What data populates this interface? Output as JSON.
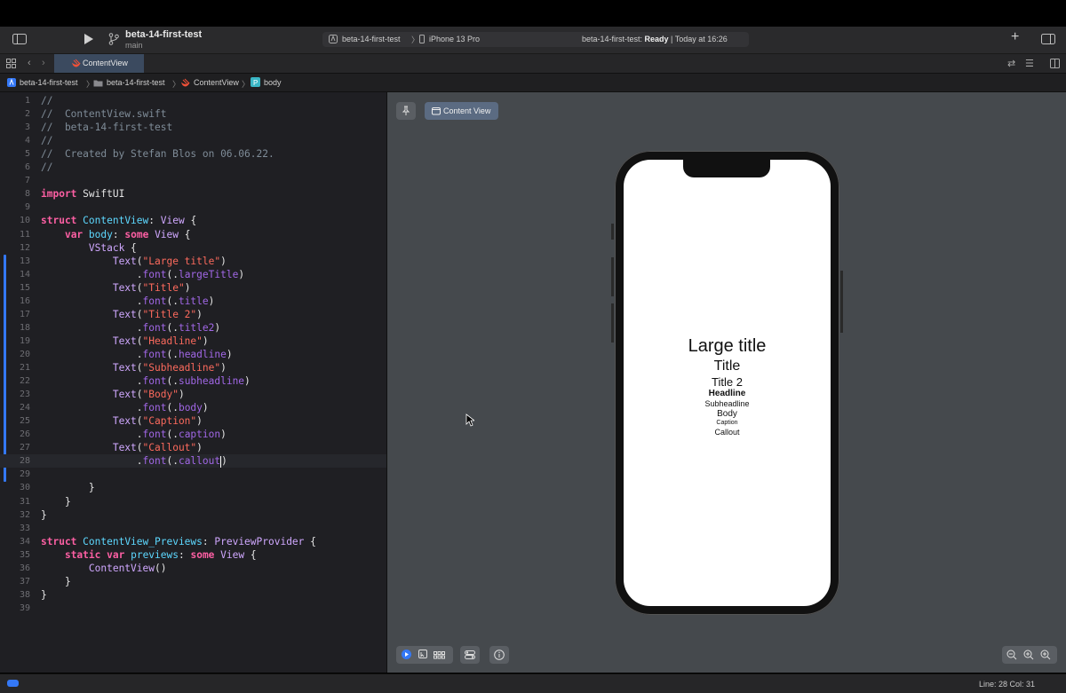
{
  "window": {
    "project_title": "beta-14-first-test",
    "branch": "main",
    "scheme": "beta-14-first-test",
    "device": "iPhone 13 Pro",
    "status_prefix": "beta-14-first-test: ",
    "status_ready": "Ready",
    "status_suffix": " | Today at 16:26"
  },
  "tabs": [
    {
      "label": "ContentView"
    }
  ],
  "jumpbar": [
    "beta-14-first-test",
    "beta-14-first-test",
    "ContentView",
    "body"
  ],
  "editor": {
    "current_line": 28,
    "lines": [
      {
        "n": "1",
        "t": [
          [
            "c",
            "//"
          ]
        ]
      },
      {
        "n": "2",
        "t": [
          [
            "c",
            "//  ContentView.swift"
          ]
        ]
      },
      {
        "n": "3",
        "t": [
          [
            "c",
            "//  beta-14-first-test"
          ]
        ]
      },
      {
        "n": "4",
        "t": [
          [
            "c",
            "//"
          ]
        ]
      },
      {
        "n": "5",
        "t": [
          [
            "c",
            "//  Created by Stefan Blos on 06.06.22."
          ]
        ]
      },
      {
        "n": "6",
        "t": [
          [
            "c",
            "//"
          ]
        ]
      },
      {
        "n": "7",
        "t": []
      },
      {
        "n": "8",
        "t": [
          [
            "k",
            "import"
          ],
          [
            "p",
            " SwiftUI"
          ]
        ]
      },
      {
        "n": "9",
        "t": []
      },
      {
        "n": "10",
        "t": [
          [
            "k",
            "struct"
          ],
          [
            "p",
            " "
          ],
          [
            "d",
            "ContentView"
          ],
          [
            "p",
            ": "
          ],
          [
            "y",
            "View"
          ],
          [
            "p",
            " {"
          ]
        ]
      },
      {
        "n": "11",
        "t": [
          [
            "p",
            "    "
          ],
          [
            "k",
            "var"
          ],
          [
            "p",
            " "
          ],
          [
            "d",
            "body"
          ],
          [
            "p",
            ": "
          ],
          [
            "k",
            "some"
          ],
          [
            "p",
            " "
          ],
          [
            "y",
            "View"
          ],
          [
            "p",
            " {"
          ]
        ]
      },
      {
        "n": "12",
        "t": [
          [
            "p",
            "        "
          ],
          [
            "y",
            "VStack"
          ],
          [
            "p",
            " {"
          ]
        ]
      },
      {
        "n": "13",
        "t": [
          [
            "p",
            "            "
          ],
          [
            "y",
            "Text"
          ],
          [
            "p",
            "("
          ],
          [
            "s",
            "\"Large title\""
          ],
          [
            "p",
            ")"
          ]
        ]
      },
      {
        "n": "14",
        "t": [
          [
            "p",
            "                ."
          ],
          [
            "f",
            "font"
          ],
          [
            "p",
            "(."
          ],
          [
            "f",
            "largeTitle"
          ],
          [
            "p",
            ")"
          ]
        ]
      },
      {
        "n": "15",
        "t": [
          [
            "p",
            "            "
          ],
          [
            "y",
            "Text"
          ],
          [
            "p",
            "("
          ],
          [
            "s",
            "\"Title\""
          ],
          [
            "p",
            ")"
          ]
        ]
      },
      {
        "n": "16",
        "t": [
          [
            "p",
            "                ."
          ],
          [
            "f",
            "font"
          ],
          [
            "p",
            "(."
          ],
          [
            "f",
            "title"
          ],
          [
            "p",
            ")"
          ]
        ]
      },
      {
        "n": "17",
        "t": [
          [
            "p",
            "            "
          ],
          [
            "y",
            "Text"
          ],
          [
            "p",
            "("
          ],
          [
            "s",
            "\"Title 2\""
          ],
          [
            "p",
            ")"
          ]
        ]
      },
      {
        "n": "18",
        "t": [
          [
            "p",
            "                ."
          ],
          [
            "f",
            "font"
          ],
          [
            "p",
            "(."
          ],
          [
            "f",
            "title2"
          ],
          [
            "p",
            ")"
          ]
        ]
      },
      {
        "n": "19",
        "t": [
          [
            "p",
            "            "
          ],
          [
            "y",
            "Text"
          ],
          [
            "p",
            "("
          ],
          [
            "s",
            "\"Headline\""
          ],
          [
            "p",
            ")"
          ]
        ]
      },
      {
        "n": "20",
        "t": [
          [
            "p",
            "                ."
          ],
          [
            "f",
            "font"
          ],
          [
            "p",
            "(."
          ],
          [
            "f",
            "headline"
          ],
          [
            "p",
            ")"
          ]
        ]
      },
      {
        "n": "21",
        "t": [
          [
            "p",
            "            "
          ],
          [
            "y",
            "Text"
          ],
          [
            "p",
            "("
          ],
          [
            "s",
            "\"Subheadline\""
          ],
          [
            "p",
            ")"
          ]
        ]
      },
      {
        "n": "22",
        "t": [
          [
            "p",
            "                ."
          ],
          [
            "f",
            "font"
          ],
          [
            "p",
            "(."
          ],
          [
            "f",
            "subheadline"
          ],
          [
            "p",
            ")"
          ]
        ]
      },
      {
        "n": "23",
        "t": [
          [
            "p",
            "            "
          ],
          [
            "y",
            "Text"
          ],
          [
            "p",
            "("
          ],
          [
            "s",
            "\"Body\""
          ],
          [
            "p",
            ")"
          ]
        ]
      },
      {
        "n": "24",
        "t": [
          [
            "p",
            "                ."
          ],
          [
            "f",
            "font"
          ],
          [
            "p",
            "(."
          ],
          [
            "f",
            "body"
          ],
          [
            "p",
            ")"
          ]
        ]
      },
      {
        "n": "25",
        "t": [
          [
            "p",
            "            "
          ],
          [
            "y",
            "Text"
          ],
          [
            "p",
            "("
          ],
          [
            "s",
            "\"Caption\""
          ],
          [
            "p",
            ")"
          ]
        ]
      },
      {
        "n": "26",
        "t": [
          [
            "p",
            "                ."
          ],
          [
            "f",
            "font"
          ],
          [
            "p",
            "(."
          ],
          [
            "f",
            "caption"
          ],
          [
            "p",
            ")"
          ]
        ]
      },
      {
        "n": "27",
        "t": [
          [
            "p",
            "            "
          ],
          [
            "y",
            "Text"
          ],
          [
            "p",
            "("
          ],
          [
            "s",
            "\"Callout\""
          ],
          [
            "p",
            ")"
          ]
        ]
      },
      {
        "n": "28",
        "t": [
          [
            "p",
            "                ."
          ],
          [
            "f",
            "font"
          ],
          [
            "p",
            "(."
          ],
          [
            "f",
            "callout"
          ],
          [
            "p",
            ")"
          ]
        ]
      },
      {
        "n": "29",
        "t": []
      },
      {
        "n": "30",
        "t": [
          [
            "p",
            "        }"
          ]
        ]
      },
      {
        "n": "31",
        "t": [
          [
            "p",
            "    }"
          ]
        ]
      },
      {
        "n": "32",
        "t": [
          [
            "p",
            "}"
          ]
        ]
      },
      {
        "n": "33",
        "t": []
      },
      {
        "n": "34",
        "t": [
          [
            "k",
            "struct"
          ],
          [
            "p",
            " "
          ],
          [
            "d",
            "ContentView_Previews"
          ],
          [
            "p",
            ": "
          ],
          [
            "y",
            "PreviewProvider"
          ],
          [
            "p",
            " {"
          ]
        ]
      },
      {
        "n": "35",
        "t": [
          [
            "p",
            "    "
          ],
          [
            "k",
            "static"
          ],
          [
            "p",
            " "
          ],
          [
            "k",
            "var"
          ],
          [
            "p",
            " "
          ],
          [
            "d",
            "previews"
          ],
          [
            "p",
            ": "
          ],
          [
            "k",
            "some"
          ],
          [
            "p",
            " "
          ],
          [
            "y",
            "View"
          ],
          [
            "p",
            " {"
          ]
        ]
      },
      {
        "n": "36",
        "t": [
          [
            "p",
            "        "
          ],
          [
            "y",
            "ContentView"
          ],
          [
            "p",
            "()"
          ]
        ]
      },
      {
        "n": "37",
        "t": [
          [
            "p",
            "    }"
          ]
        ]
      },
      {
        "n": "38",
        "t": [
          [
            "p",
            "}"
          ]
        ]
      },
      {
        "n": "39",
        "t": []
      }
    ]
  },
  "preview": {
    "content_view_button": "Content View",
    "texts": {
      "large_title": "Large title",
      "title": "Title",
      "title2": "Title 2",
      "headline": "Headline",
      "subheadline": "Subheadline",
      "body": "Body",
      "caption": "Caption",
      "callout": "Callout"
    }
  },
  "statusbar": {
    "position": "Line: 28  Col: 31"
  },
  "colors": {
    "accent": "#3478f6",
    "keyword": "#fc5fa3",
    "string": "#fc6a5d",
    "type": "#d0a8ff",
    "decl": "#5dd8ff",
    "comment": "#7f8c98"
  }
}
